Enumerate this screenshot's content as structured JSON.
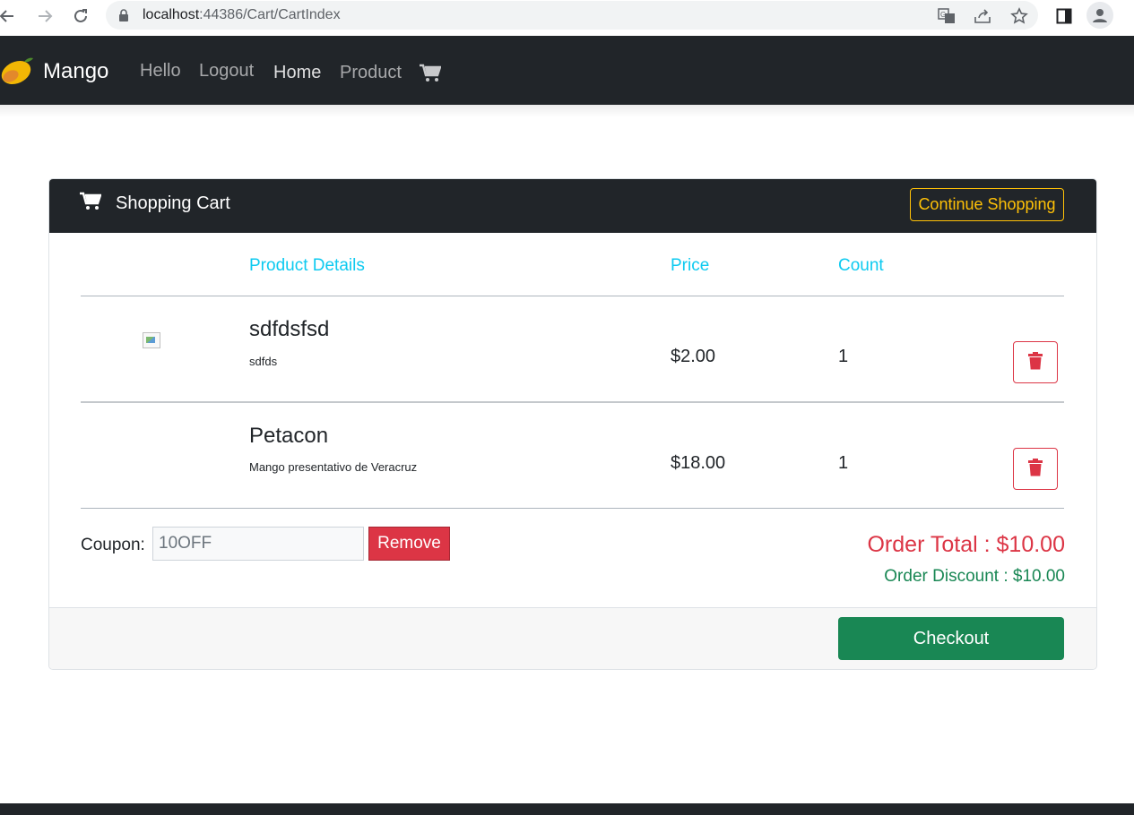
{
  "browser": {
    "url_host": "localhost",
    "url_path": ":44386/Cart/CartIndex",
    "icons": [
      "back-icon",
      "forward-icon",
      "reload-icon",
      "lock-icon",
      "translate-icon",
      "share-icon",
      "bookmark-star-icon",
      "side-panel-icon",
      "profile-icon"
    ]
  },
  "navbar": {
    "brand": "Mango",
    "links": [
      "Hello",
      "Logout",
      "Home",
      "Product"
    ],
    "cart_icon": "cart-icon"
  },
  "cart": {
    "title": "Shopping Cart",
    "continue_label": "Continue Shopping",
    "columns": [
      "Product Details",
      "Price",
      "Count"
    ],
    "items": [
      {
        "name": "sdfdsfsd",
        "description": "sdfds",
        "price": "$2.00",
        "count": "1"
      },
      {
        "name": "Petacon",
        "description": "Mango presentativo de Veracruz",
        "price": "$18.00",
        "count": "1"
      }
    ],
    "coupon_label": "Coupon:",
    "coupon_value": "10OFF",
    "remove_label": "Remove",
    "order_total": "Order Total : $10.00",
    "order_discount": "Order Discount : $10.00",
    "checkout_label": "Checkout"
  },
  "colors": {
    "navbar_bg": "#212529",
    "accent_info": "#0dcaf0",
    "danger": "#dc3545",
    "success": "#198754",
    "warning": "#ffc107"
  }
}
